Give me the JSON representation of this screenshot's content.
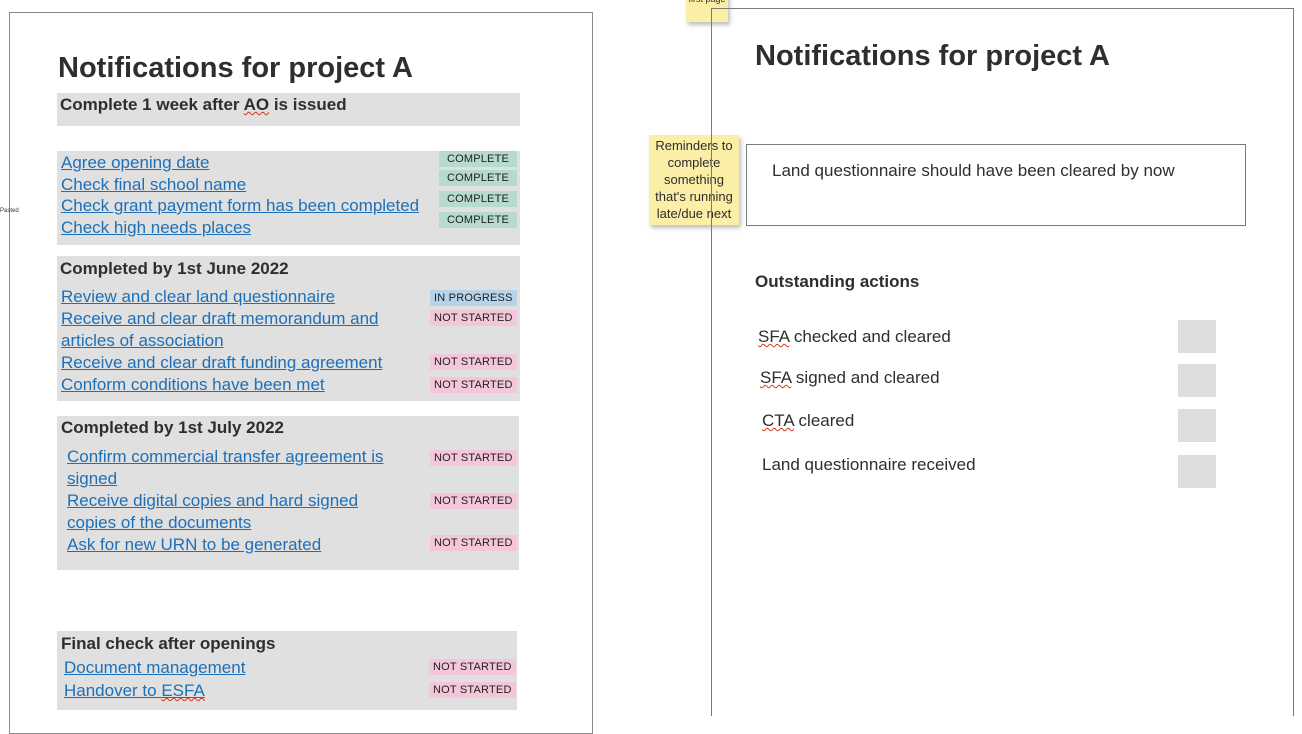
{
  "left": {
    "title": "Notifications for project A",
    "banner_pre": "Complete 1 week after ",
    "banner_ao": "AO",
    "banner_post": " is issued",
    "side_note": "Pasted",
    "group1": {
      "items": [
        {
          "label": "Agree opening date",
          "status": "COMPLETE"
        },
        {
          "label": "Check final school name",
          "status": "COMPLETE"
        },
        {
          "label": "Check grant payment form has been completed",
          "status": "COMPLETE"
        },
        {
          "label": "Check high needs places",
          "status": "COMPLETE"
        }
      ]
    },
    "group2": {
      "heading": "Completed by 1st June 2022",
      "items": [
        {
          "label": "Review and clear land questionnaire",
          "status": "IN PROGRESS"
        },
        {
          "label": "Receive and clear draft memorandum and articles of association",
          "status": "NOT STARTED"
        },
        {
          "label": "Receive and clear draft funding agreement",
          "status": "NOT STARTED"
        },
        {
          "label": "Conform conditions have been met",
          "status": "NOT STARTED"
        }
      ]
    },
    "group3": {
      "heading": "Completed by 1st July 2022",
      "items": [
        {
          "label": "Confirm commercial transfer agreement is signed",
          "status": "NOT STARTED"
        },
        {
          "label": "Receive digital copies and hard signed copies of the documents",
          "status": "NOT STARTED"
        },
        {
          "label": "Ask for new URN to be generated",
          "status": "NOT STARTED"
        }
      ]
    },
    "group4": {
      "heading": "Final check after openings",
      "items": [
        {
          "label": "Document management",
          "status": "NOT STARTED"
        },
        {
          "label_pre": "Handover to ",
          "label_esfa": "ESFA",
          "status": "NOT STARTED"
        }
      ]
    }
  },
  "stickies": {
    "first_page": "first page",
    "reminder": "Reminders to complete something that's running late/due next"
  },
  "right": {
    "title": "Notifications for project A",
    "alert": "Land questionnaire should have been cleared by now",
    "outstanding_heading": "Outstanding actions",
    "actions": [
      {
        "abbr": "SFA",
        "rest": " checked and cleared"
      },
      {
        "abbr": "SFA",
        "rest": " signed and cleared"
      },
      {
        "abbr": "CTA",
        "rest": " cleared"
      },
      {
        "abbr": "",
        "rest": "Land questionnaire received"
      }
    ]
  },
  "colors": {
    "link": "#1d70b8",
    "complete_tag": "#b6dbcc",
    "in_progress_tag": "#b6d3ea",
    "not_started_tag": "#f4c6d9",
    "sticky": "#fbeea6"
  }
}
